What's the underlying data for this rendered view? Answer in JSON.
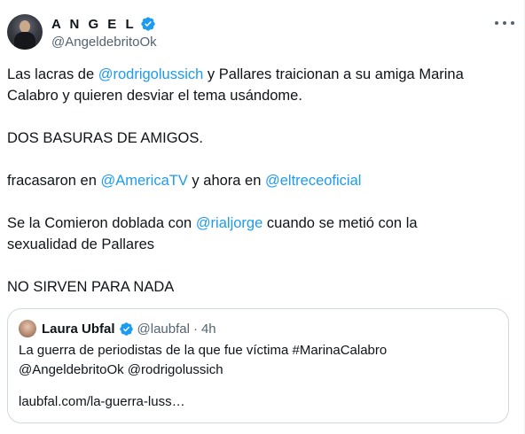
{
  "tweet": {
    "author": {
      "display_name": "A N G E L",
      "handle": "@AngeldebritoOk",
      "verified": true
    },
    "more_icon": "more-horizontal-icon",
    "lines": [
      {
        "parts": [
          {
            "t": "Las lacras de ",
            "m": false
          },
          {
            "t": "@rodrigolussich",
            "m": true
          },
          {
            "t": " y Pallares traicionan a su amiga Marina",
            "m": false
          }
        ]
      },
      {
        "parts": [
          {
            "t": "Calabro y quieren desviar el tema usándome.",
            "m": false
          }
        ]
      },
      {
        "gap": true
      },
      {
        "parts": [
          {
            "t": "DOS BASURAS DE AMIGOS.",
            "m": false
          }
        ]
      },
      {
        "gap": true
      },
      {
        "parts": [
          {
            "t": "fracasaron en ",
            "m": false
          },
          {
            "t": "@AmericaTV",
            "m": true
          },
          {
            "t": " y ahora en ",
            "m": false
          },
          {
            "t": "@eltreceoficial",
            "m": true
          }
        ]
      },
      {
        "gap": true
      },
      {
        "parts": [
          {
            "t": "Se la Comieron doblada con ",
            "m": false
          },
          {
            "t": "@rialjorge",
            "m": true
          },
          {
            "t": " cuando se metió con la",
            "m": false
          }
        ]
      },
      {
        "parts": [
          {
            "t": "sexualidad de Pallares",
            "m": false
          }
        ]
      },
      {
        "gap": true
      },
      {
        "parts": [
          {
            "t": "NO SIRVEN PARA NADA",
            "m": false
          }
        ]
      }
    ]
  },
  "quote": {
    "display_name": "Laura Ubfal",
    "handle": "@laubfal",
    "separator": "·",
    "time": "4h",
    "verified": true,
    "text_line1": "La guerra de periodistas de la que fue víctima #MarinaCalabro",
    "text_line2": "@AngeldebritoOk @rodrigolussich",
    "link": "laubfal.com/la-guerra-luss…"
  },
  "colors": {
    "accent": "#1d9bf0",
    "text": "#0f1419",
    "secondary": "#536471",
    "border": "#cfd9de"
  }
}
